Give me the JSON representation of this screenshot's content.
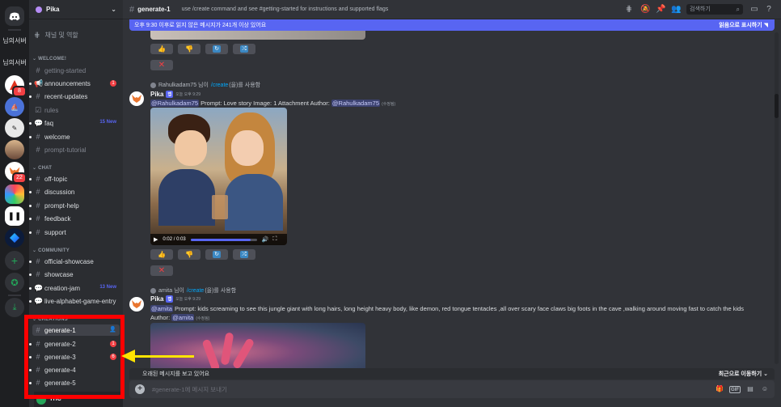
{
  "rail": {
    "server_texts": [
      "님의서버",
      "님의서버"
    ],
    "badges": [
      "8",
      "22"
    ],
    "colors": {
      "accent": "#5865f2",
      "green": "#23a559",
      "red": "#f23f43"
    }
  },
  "sidebar": {
    "server_name": "Pika",
    "browse_label": "채널 및 역할",
    "categories": {
      "welcome": "WELCOME!",
      "chat": "CHAT",
      "community": "COMMUNITY",
      "creations": "CREATIONS"
    },
    "channels": [
      {
        "name": "getting-started"
      },
      {
        "name": "announcements",
        "badge": "1"
      },
      {
        "name": "recent-updates"
      },
      {
        "name": "rules"
      },
      {
        "name": "faq",
        "tag": "15 New"
      },
      {
        "name": "welcome"
      },
      {
        "name": "prompt-tutorial"
      },
      {
        "name": "off-topic"
      },
      {
        "name": "discussion"
      },
      {
        "name": "prompt-help"
      },
      {
        "name": "feedback"
      },
      {
        "name": "support"
      },
      {
        "name": "official-showcase"
      },
      {
        "name": "showcase"
      },
      {
        "name": "creation-jam",
        "tag": "13 New"
      },
      {
        "name": "live-alphabet-game-entry"
      },
      {
        "name": "generate-1"
      },
      {
        "name": "generate-2",
        "badge": "1"
      },
      {
        "name": "generate-3",
        "badge": "6"
      },
      {
        "name": "generate-4"
      },
      {
        "name": "generate-5"
      }
    ],
    "user_partial": "YHC"
  },
  "topbar": {
    "channel": "generate-1",
    "topic": "use /create command and see #getting-started for instructions and supported flags",
    "search_placeholder": "검색하기"
  },
  "banner": {
    "text": "오후 9:30 이후로 읽지 않은 메시지가 241개 이상 있어요",
    "mark_read": "읽음으로 표시하기"
  },
  "messages": [
    {
      "reply_user": "Rahulkadam75",
      "reply_mid": "님이",
      "reply_cmd": "/create",
      "reply_end": "(을)를 사용함",
      "author": "Pika",
      "app_tag": "앱",
      "time": "오늘 오후 9:29",
      "mention": "@Rahulkadam75",
      "body": " Prompt: Love story  Image: 1 Attachment  Author: ",
      "author_mention": "@Rahulkadam75",
      "edited": "(수정됨)",
      "video_time": "0:02 / 0:03",
      "video_progress": 0.9
    },
    {
      "reply_user": "amita",
      "reply_mid": "님이",
      "reply_cmd": "/create",
      "reply_end": "(을)를 사용함",
      "author": "Pika",
      "app_tag": "앱",
      "time": "오늘 오후 9:29",
      "mention": "@amita",
      "body": " Prompt: kids screaming to see this jungle giant with long hairs, long height heavy body, like demon, red tongue tentacles ,all over scary face claws big foots  in the cave  ,walking around moving fast to catch the kids",
      "author_label": "Author: ",
      "author_mention": "@amita",
      "edited": "(수정됨)"
    }
  ],
  "oldbar": {
    "text": "오래된 메시지를 보고 있어요",
    "jump": "최근으로 이동하기"
  },
  "composer": {
    "placeholder": "#generate-1에 메시지 보내기"
  },
  "annotation": {
    "highlight_color": "#ff0000",
    "arrow_color": "#ffe500"
  }
}
